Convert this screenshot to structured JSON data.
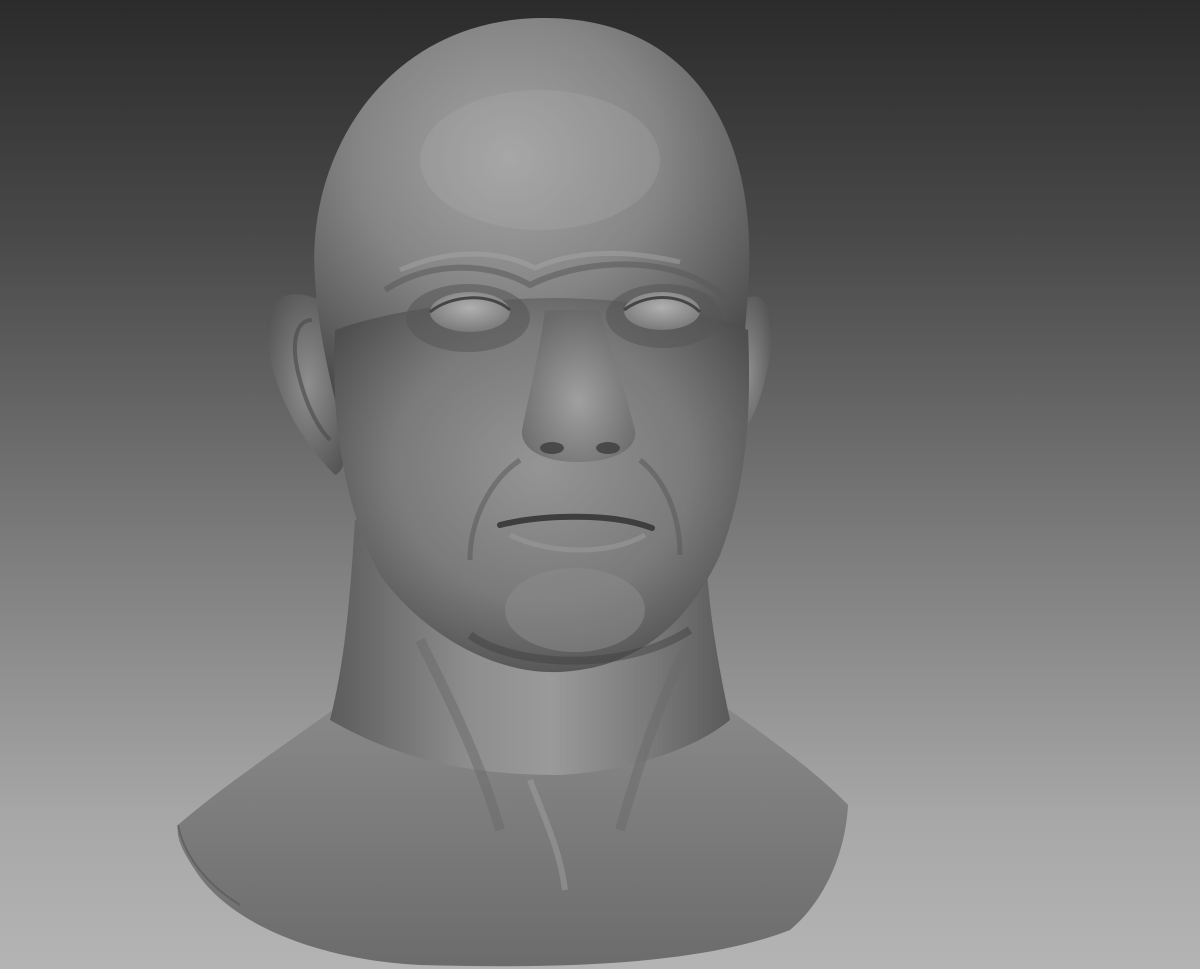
{
  "viewport": {
    "subject_icon": "sculpted-head-icon",
    "colors": {
      "background_top": "#2b2b2b",
      "background_bottom": "#b4b4b4",
      "clay": "#7c7c7c",
      "clay_highlight": "#a9a9a9",
      "clay_shadow": "#3e3e3e"
    }
  }
}
